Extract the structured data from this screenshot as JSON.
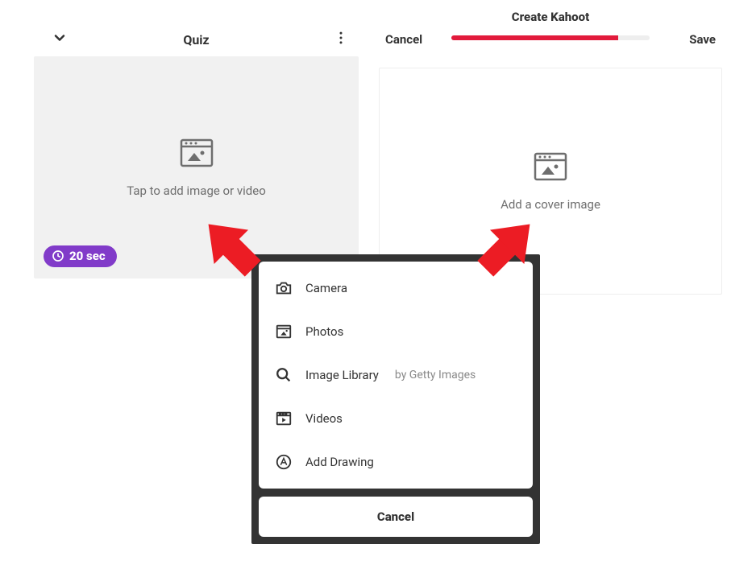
{
  "left_panel": {
    "title": "Quiz",
    "placeholder": "Tap to add image or video",
    "time_label": "20 sec"
  },
  "right_panel": {
    "cancel": "Cancel",
    "title": "Create Kahoot",
    "save": "Save",
    "placeholder": "Add a cover image"
  },
  "popup": {
    "items": {
      "camera": "Camera",
      "photos": "Photos",
      "image_library": "Image Library",
      "image_library_sub": "by Getty Images",
      "videos": "Videos",
      "add_drawing": "Add Drawing"
    },
    "cancel": "Cancel"
  }
}
